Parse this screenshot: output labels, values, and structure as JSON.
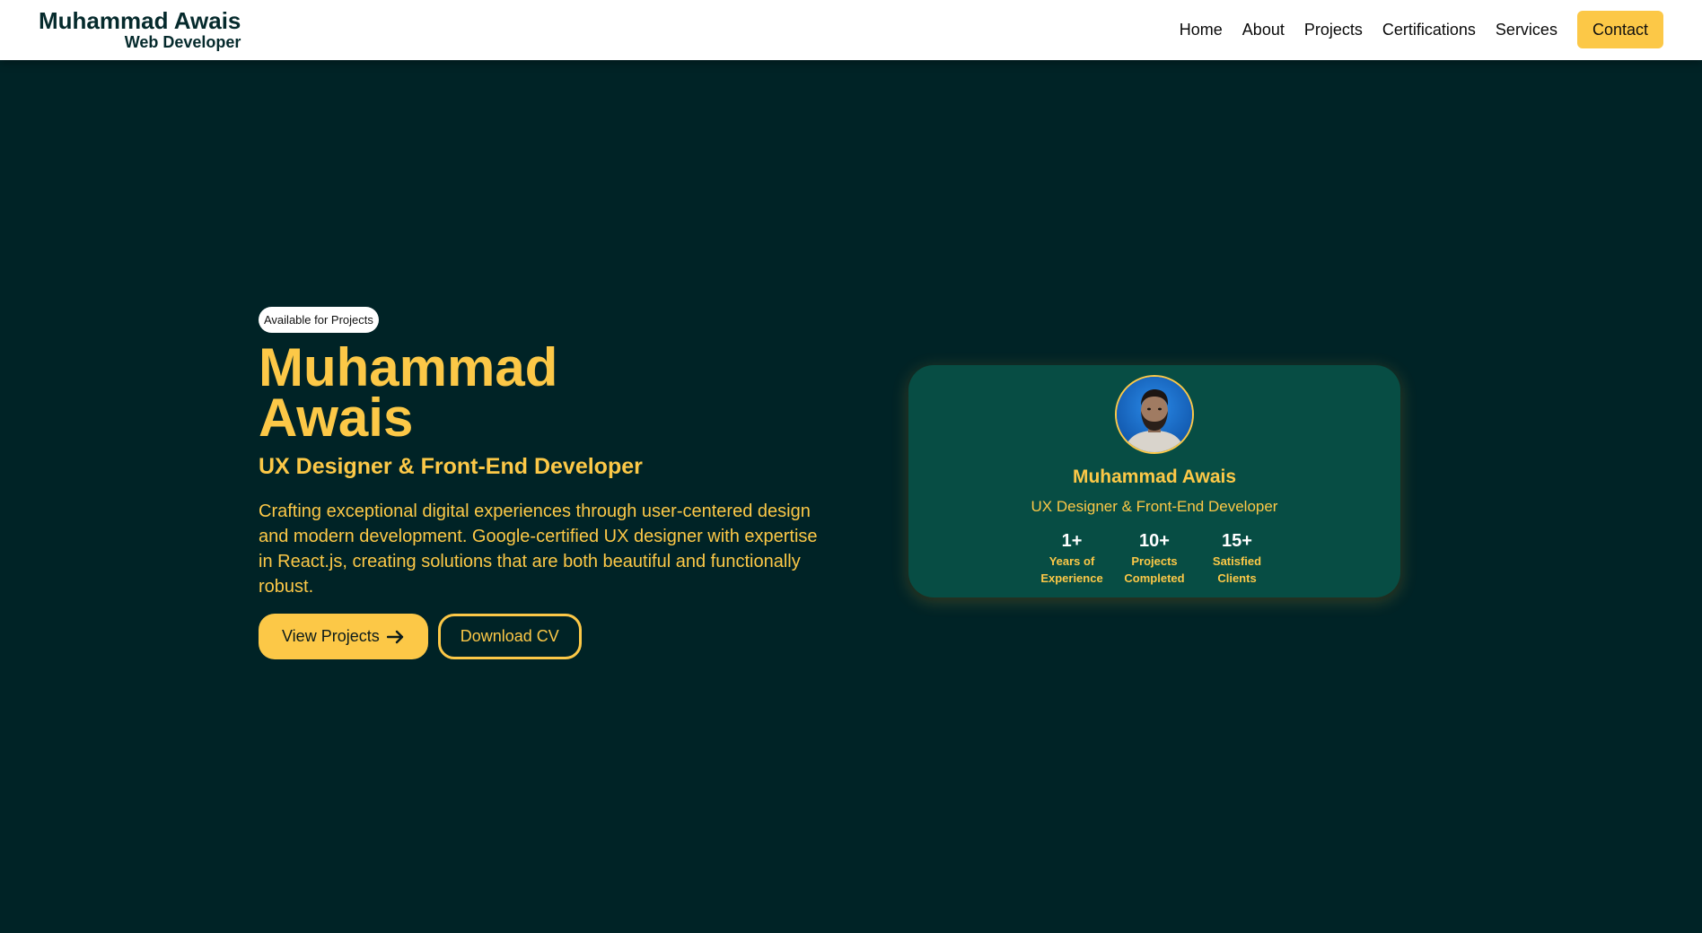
{
  "header": {
    "brand_name": "Muhammad Awais",
    "brand_role": "Web Developer",
    "nav": [
      "Home",
      "About",
      "Projects",
      "Certifications",
      "Services"
    ],
    "contact_label": "Contact"
  },
  "hero": {
    "badge": "Available for Projects",
    "name": "Muhammad Awais",
    "role": "UX Designer & Front-End Developer",
    "description": "Crafting exceptional digital experiences through user-centered design and modern development. Google-certified UX designer with expertise in React.js, creating solutions that are both beautiful and functionally robust.",
    "primary_button": "View Projects",
    "secondary_button": "Download CV"
  },
  "card": {
    "name": "Muhammad Awais",
    "role": "UX Designer & Front-End Developer",
    "stats": [
      {
        "value": "1+",
        "label": "Years of Experience"
      },
      {
        "value": "10+",
        "label": "Projects Completed"
      },
      {
        "value": "15+",
        "label": "Satisfied Clients"
      }
    ]
  },
  "colors": {
    "background": "#002326",
    "accent": "#fcc847",
    "card": "#074d44",
    "header": "#ffffff"
  },
  "icons": {
    "button_arrow": "arrow-right-icon",
    "avatar": "profile-photo"
  }
}
